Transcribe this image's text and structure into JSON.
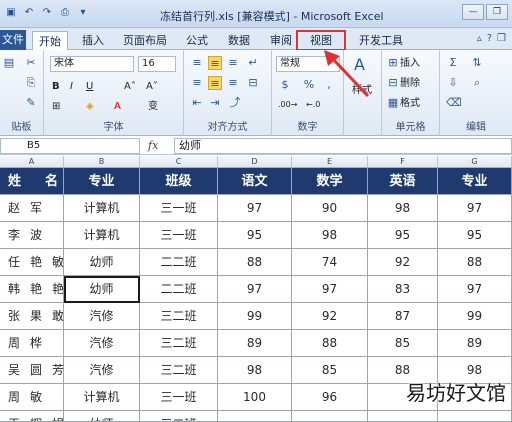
{
  "window": {
    "title": "冻结首行列.xls  [兼容模式] - Microsoft Excel",
    "qat_icons": [
      "save-icon",
      "undo-icon",
      "redo-icon",
      "print-preview-icon",
      "customize-icon"
    ]
  },
  "tabs": {
    "file": "文件",
    "items": [
      "开始",
      "插入",
      "页面布局",
      "公式",
      "数据",
      "审阅",
      "视图",
      "开发工具"
    ],
    "active": "开始",
    "highlighted": "视图"
  },
  "ribbon": {
    "font_name": "宋体",
    "font_size": "16",
    "number_format": "常规",
    "insert_label": "插入",
    "delete_label": "删除",
    "format_label": "格式",
    "style_label": "样式",
    "groups": {
      "clipboard": "贴板",
      "font": "字体",
      "alignment": "对齐方式",
      "number": "数字",
      "cells": "单元格",
      "editing": "编辑"
    }
  },
  "formula_bar": {
    "name_box": "B5",
    "fx": "fx",
    "content": "幼师"
  },
  "grid": {
    "column_letters": [
      "A",
      "B",
      "C",
      "D",
      "E",
      "F",
      "G"
    ],
    "headers": [
      "姓名",
      "专业",
      "班级",
      "语文",
      "数学",
      "英语",
      "专业"
    ],
    "rows": [
      [
        "赵军",
        "计算机",
        "三一班",
        "97",
        "90",
        "98",
        "97"
      ],
      [
        "李波",
        "计算机",
        "三一班",
        "95",
        "98",
        "95",
        "95"
      ],
      [
        "任艳敏",
        "幼师",
        "二二班",
        "88",
        "74",
        "92",
        "88"
      ],
      [
        "韩艳艳",
        "幼师",
        "二二班",
        "97",
        "97",
        "83",
        "97"
      ],
      [
        "张果敢",
        "汽修",
        "三二班",
        "99",
        "92",
        "87",
        "99"
      ],
      [
        "周桦",
        "汽修",
        "三二班",
        "89",
        "88",
        "85",
        "89"
      ],
      [
        "吴圆芳",
        "汽修",
        "三二班",
        "98",
        "85",
        "88",
        "98"
      ],
      [
        "周敏",
        "计算机",
        "三一班",
        "100",
        "96",
        "",
        ""
      ],
      [
        "王辉娟",
        "幼师",
        "三二班",
        "",
        "",
        "",
        ""
      ]
    ]
  },
  "watermark": "易坊好文馆",
  "colors": {
    "header_bg": "#1e3a6e",
    "highlight_red": "#e03030",
    "file_tab": "#2b5797"
  }
}
